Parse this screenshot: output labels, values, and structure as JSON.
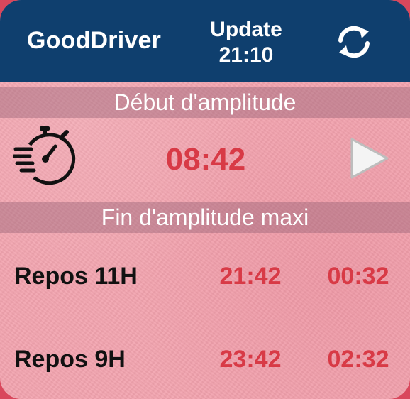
{
  "header": {
    "app_name": "GoodDriver",
    "update_label": "Update",
    "update_time": "21:10",
    "refresh_icon": "refresh-icon"
  },
  "amplitude_start": {
    "label": "Début d'amplitude",
    "time": "08:42",
    "stopwatch_icon": "stopwatch-icon",
    "play_icon": "play-icon"
  },
  "amplitude_end": {
    "label": "Fin d'amplitude maxi",
    "rows": [
      {
        "label": "Repos 11H",
        "time1": "21:42",
        "time2": "00:32"
      },
      {
        "label": "Repos 9H",
        "time1": "23:42",
        "time2": "02:32"
      }
    ]
  },
  "colors": {
    "header_bg": "#0f3f6e",
    "background": "#f2a3ae",
    "time_red": "#d83a46",
    "band": "#a06b7e"
  }
}
